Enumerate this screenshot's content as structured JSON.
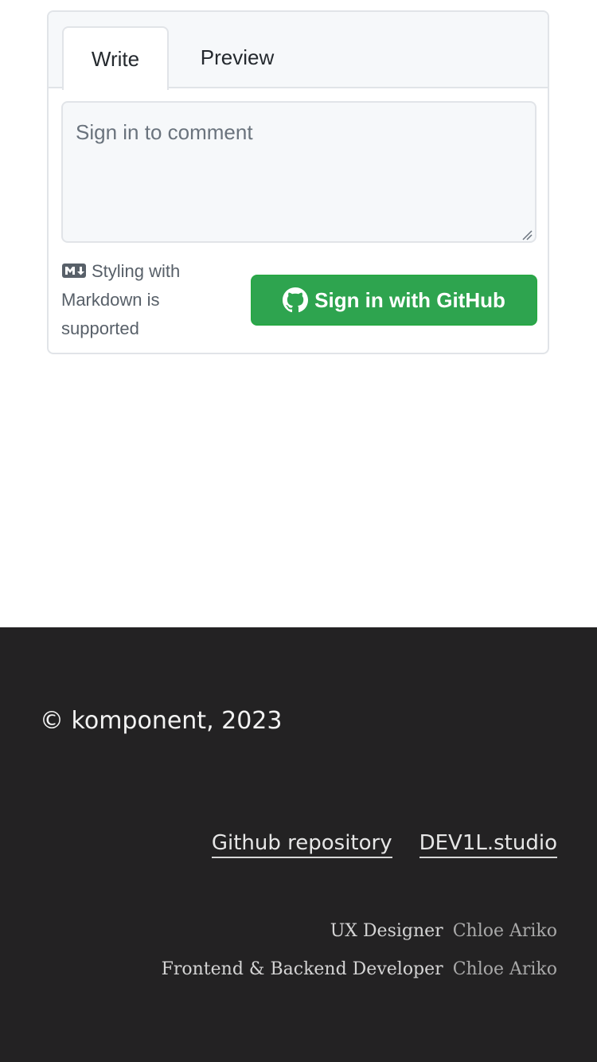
{
  "comment_widget": {
    "tabs": [
      {
        "label": "Write",
        "active": true
      },
      {
        "label": "Preview",
        "active": false
      }
    ],
    "textarea": {
      "placeholder": "Sign in to comment",
      "value": ""
    },
    "markdown_note": "Styling with Markdown is supported",
    "markdown_icon": "markdown-icon",
    "sign_in_button": {
      "label": "Sign in with GitHub",
      "icon": "github-icon",
      "color": "#2ea44f"
    }
  },
  "footer": {
    "background": "#232223",
    "copyright": "© komponent, 2023",
    "links": [
      {
        "label": "Github repository"
      },
      {
        "label": "DEV1L.studio"
      }
    ],
    "credits": [
      {
        "role": "UX Designer",
        "name": "Chloe Ariko"
      },
      {
        "role": "Frontend & Backend Developer",
        "name": "Chloe Ariko"
      }
    ]
  }
}
